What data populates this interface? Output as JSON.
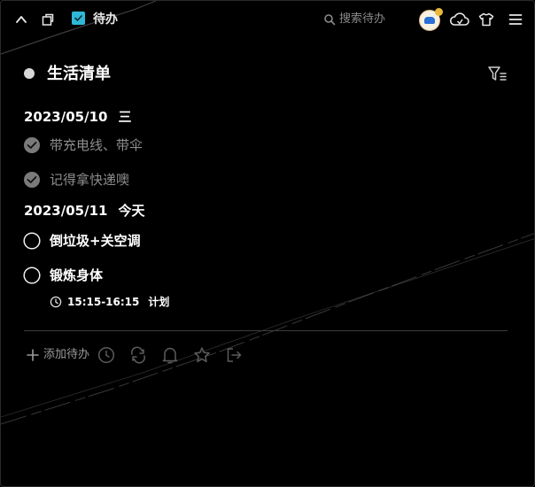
{
  "app": {
    "title": "待办",
    "search_placeholder": "搜索待办",
    "accent_color": "#2fb8d6"
  },
  "toolbar": {
    "icons": [
      "chevron-up-icon",
      "window-icon",
      "search-icon",
      "avatar",
      "cloud-sync-icon",
      "tshirt-icon",
      "menu-icon"
    ]
  },
  "list": {
    "name": "生活清单",
    "dot_color": "#d8d8d8"
  },
  "groups": [
    {
      "date": "2023/05/10",
      "weekday": "三",
      "items": [
        {
          "text": "带充电线、带伞",
          "done": true
        },
        {
          "text": "记得拿快递噢",
          "done": true
        }
      ]
    },
    {
      "date": "2023/05/11",
      "weekday": "今天",
      "items": [
        {
          "text": "倒垃圾+关空调",
          "done": false
        },
        {
          "text": "锻炼身体",
          "done": false,
          "time": "15:15-16:15",
          "tag": "计划"
        }
      ]
    }
  ],
  "footer": {
    "add_label": "添加待办",
    "tools": [
      "clock-icon",
      "repeat-icon",
      "bell-icon",
      "star-icon",
      "export-icon"
    ]
  }
}
